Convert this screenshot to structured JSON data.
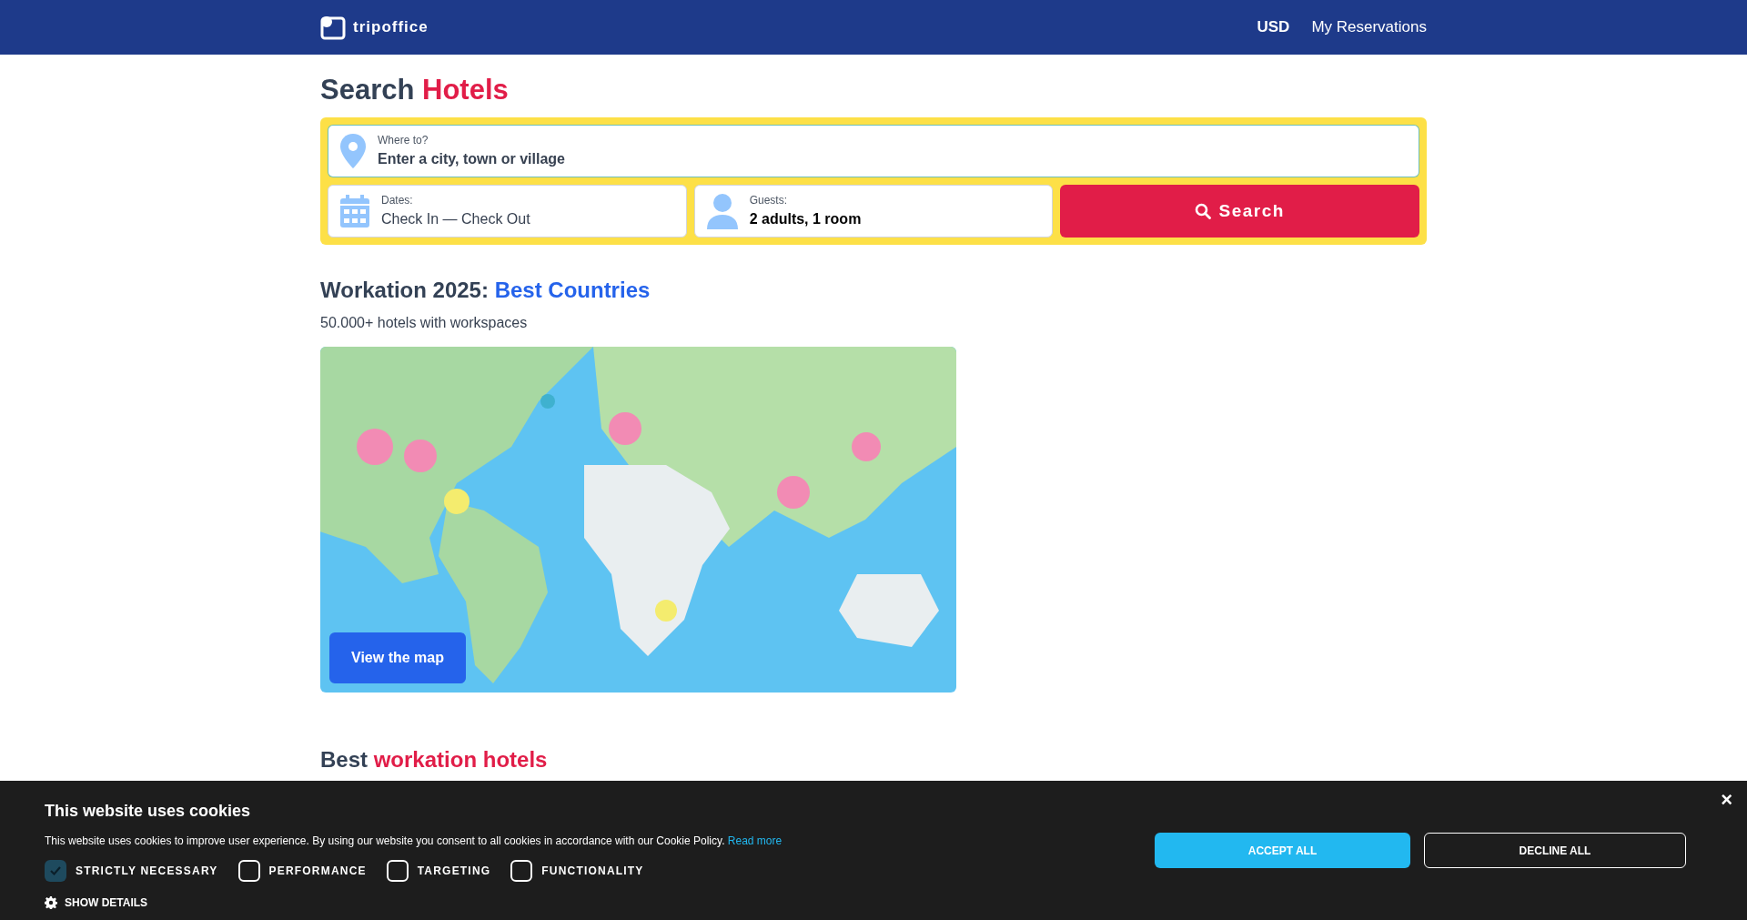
{
  "header": {
    "logo": "tripoffice",
    "nav": [
      {
        "label": "USD",
        "kind": "currency"
      },
      {
        "label": "My Reservations",
        "kind": "link"
      }
    ]
  },
  "search": {
    "title": "Search",
    "title_accent": "Hotels",
    "destination": {
      "label": "Where to?",
      "placeholder": "Enter a city, town or village"
    },
    "dates": {
      "label": "Dates:",
      "placeholder": "Check In — Check Out"
    },
    "guests": {
      "label": "Guests:",
      "value": "2 adults, 1 room"
    },
    "button": "Search"
  },
  "workation": {
    "title": "Workation 2025:",
    "title_accent": "Best Countries",
    "subtitle": "50.000+ hotels with workspaces",
    "map": {
      "kind": "picture",
      "button": "View the map"
    }
  },
  "next_section": {
    "title": "Best",
    "title_accent": "workation hotels"
  },
  "cookie_banner": {
    "title": "This website uses cookies",
    "text": "This website uses cookies to improve user experience. By using our website you consent to all cookies in accordance with our Cookie Policy.",
    "link": "Read more",
    "options": [
      {
        "label": "STRICTLY NECESSARY",
        "checked": true
      },
      {
        "label": "PERFORMANCE",
        "checked": false
      },
      {
        "label": "TARGETING",
        "checked": false
      },
      {
        "label": "FUNCTIONALITY",
        "checked": false
      }
    ],
    "show_details": "SHOW DETAILS",
    "accept": "ACCEPT ALL",
    "decline": "DECLINE ALL",
    "close": "×"
  }
}
